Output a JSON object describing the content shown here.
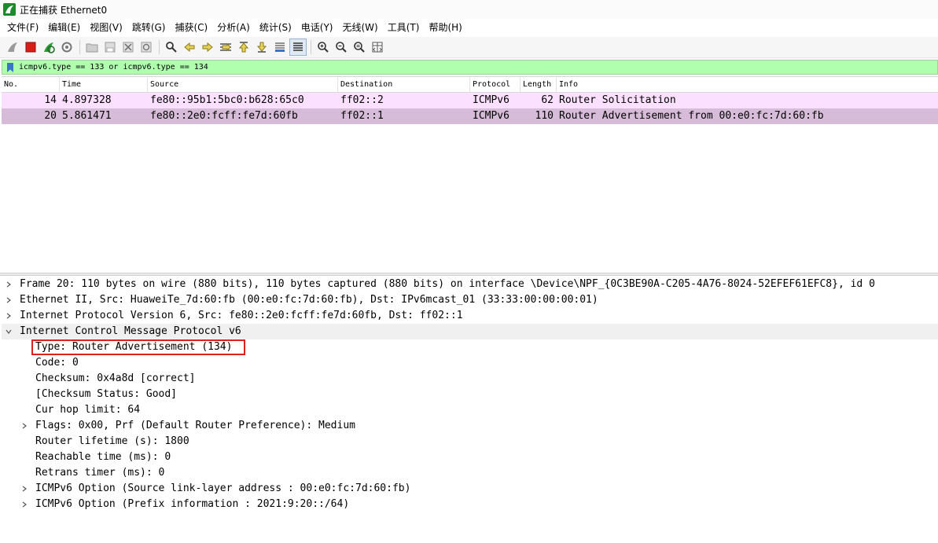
{
  "window": {
    "title": "正在捕获 Ethernet0"
  },
  "menu": [
    "文件(F)",
    "编辑(E)",
    "视图(V)",
    "跳转(G)",
    "捕获(C)",
    "分析(A)",
    "统计(S)",
    "电话(Y)",
    "无线(W)",
    "工具(T)",
    "帮助(H)"
  ],
  "toolbar": {
    "icons": [
      "shark-fin-start-icon",
      "stop-icon",
      "restart-icon",
      "capture-options-icon",
      "open-file-icon",
      "save-file-icon",
      "close-file-icon",
      "reload-icon",
      "find-icon",
      "go-back-icon",
      "go-forward-icon",
      "go-to-packet-icon",
      "first-packet-icon",
      "last-packet-icon",
      "autoscroll-icon",
      "colorize-icon",
      "zoom-in-icon",
      "zoom-out-icon",
      "normal-size-icon",
      "resize-columns-icon"
    ]
  },
  "filter": {
    "value": "icmpv6.type == 133 or icmpv6.type == 134",
    "bg_color": "#afffaf"
  },
  "packet_list": {
    "columns": [
      "No.",
      "Time",
      "Source",
      "Destination",
      "Protocol",
      "Length",
      "Info"
    ],
    "rows": [
      {
        "no": "14",
        "time": "4.897328",
        "source": "fe80::95b1:5bc0:b628:65c0",
        "destination": "ff02::2",
        "protocol": "ICMPv6",
        "length": "62",
        "info": "Router Solicitation"
      },
      {
        "no": "20",
        "time": "5.861471",
        "source": "fe80::2e0:fcff:fe7d:60fb",
        "destination": "ff02::1",
        "protocol": "ICMPv6",
        "length": "110",
        "info": "Router Advertisement from 00:e0:fc:7d:60:fb"
      }
    ]
  },
  "details": {
    "frame": "Frame 20: 110 bytes on wire (880 bits), 110 bytes captured (880 bits) on interface \\Device\\NPF_{0C3BE90A-C205-4A76-8024-52EFEF61EFC8}, id 0",
    "ethernet": "Ethernet II, Src: HuaweiTe_7d:60:fb (00:e0:fc:7d:60:fb), Dst: IPv6mcast_01 (33:33:00:00:00:01)",
    "ipv6": "Internet Protocol Version 6, Src: fe80::2e0:fcff:fe7d:60fb, Dst: ff02::1",
    "icmpv6": "Internet Control Message Protocol v6",
    "fields": {
      "type": "Type: Router Advertisement (134)",
      "code": "Code: 0",
      "checksum": "Checksum: 0x4a8d [correct]",
      "checksum_status": "[Checksum Status: Good]",
      "cur_hop_limit": "Cur hop limit: 64",
      "flags": "Flags: 0x00, Prf (Default Router Preference): Medium",
      "router_lifetime": "Router lifetime (s): 1800",
      "reachable_time": "Reachable time (ms): 0",
      "retrans_timer": "Retrans timer (ms): 0",
      "option_source_ll": "ICMPv6 Option (Source link-layer address : 00:e0:fc:7d:60:fb)",
      "option_prefix": "ICMPv6 Option (Prefix information : 2021:9:20::/64)"
    }
  },
  "colors": {
    "row_solicitation": "#fce0ff",
    "row_advertisement_selected": "#d6bcd8",
    "highlight_box": "#e0201a"
  }
}
